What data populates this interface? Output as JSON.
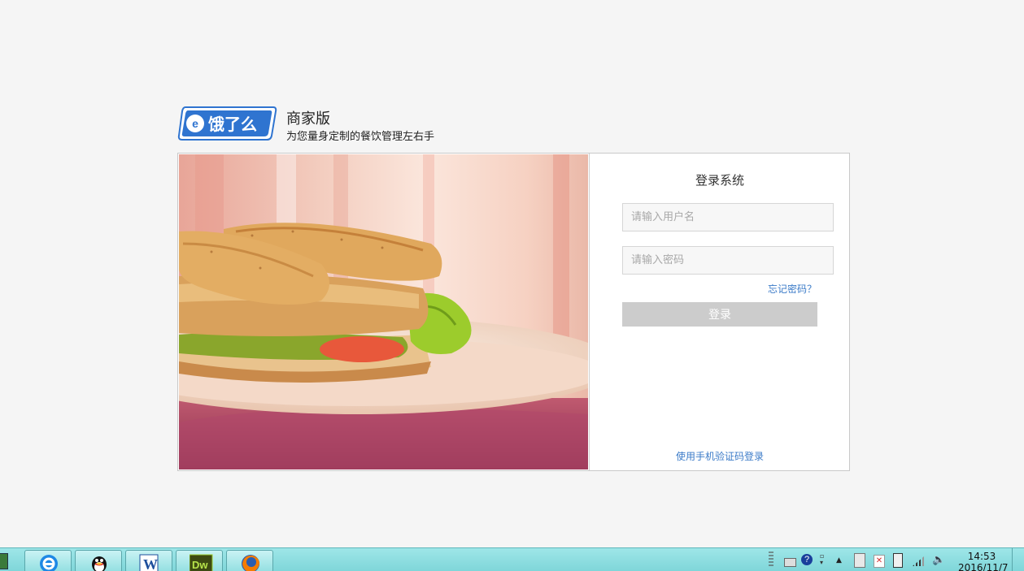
{
  "brand": {
    "logo_text": "饿了么",
    "name": "商家版",
    "slogan": "为您量身定制的餐饮管理左右手"
  },
  "login": {
    "title": "登录系统",
    "username_placeholder": "请输入用户名",
    "password_placeholder": "请输入密码",
    "forgot_label": "忘记密码？",
    "submit_label": "登录",
    "sms_login_label": "使用手机验证码登录"
  },
  "taskbar": {
    "apps": [
      "ele-icon",
      "qq-icon",
      "word-icon",
      "dreamweaver-icon",
      "firefox-icon"
    ],
    "dreamweaver_label": "Dw",
    "word_label": "W",
    "clock_time": "14:53",
    "clock_date": "2016/11/7"
  },
  "colors": {
    "brand_blue": "#2f74d0",
    "link_blue": "#3b7bc8",
    "button_disabled": "#cccccc",
    "taskbar": "#8ddfe1"
  }
}
